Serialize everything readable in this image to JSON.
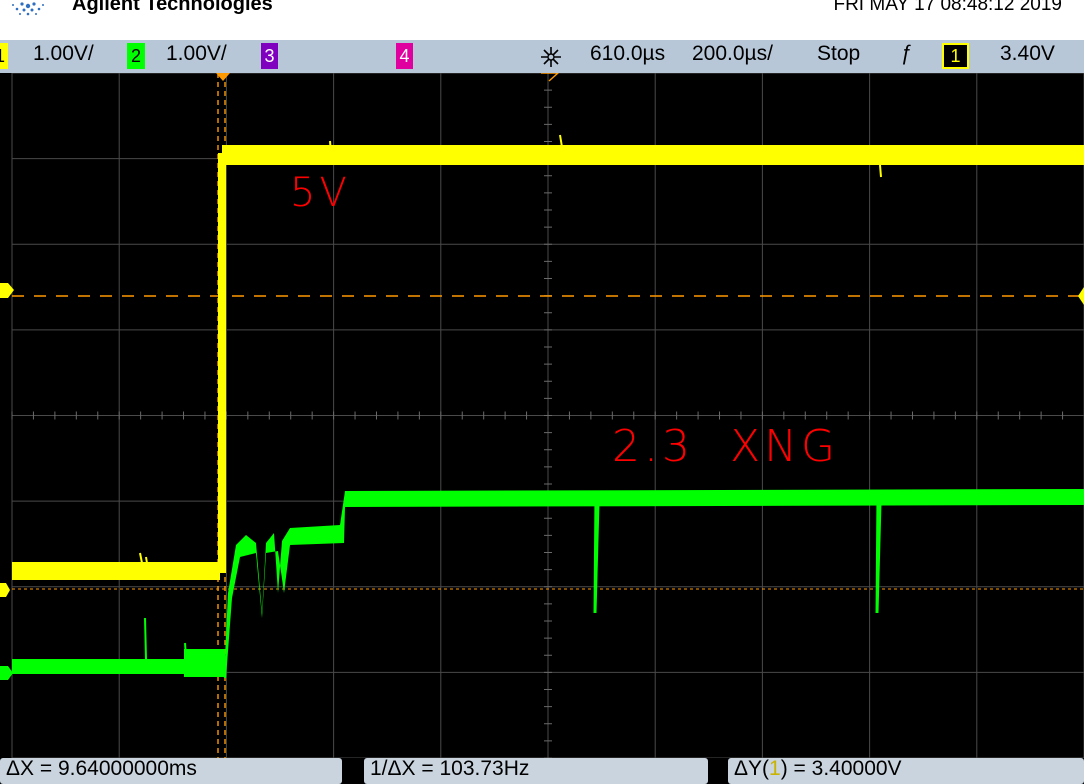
{
  "header": {
    "brand": "Agilent Technologies",
    "datetime": "FRI MAY 17 08:48:12 2019"
  },
  "status_bar": {
    "ch1_num": "1",
    "ch1_scale": "1.00V/",
    "ch2_num": "2",
    "ch2_scale": "1.00V/",
    "ch3_num": "3",
    "ch4_num": "4",
    "trigger_delay": "610.0µs",
    "timebase": "200.0µs/",
    "run_state": "Stop",
    "trigger_edge": "ƒ",
    "trigger_source": "1",
    "trigger_level": "3.40V"
  },
  "annotations": {
    "yellow_label": "5V",
    "green_label": "2.3  XNG"
  },
  "measurements": {
    "delta_x": "ΔX = 9.64000000ms",
    "inv_delta_x": "1/ΔX = 103.73Hz",
    "delta_y_prefix": "ΔY(",
    "delta_y_ch": "1",
    "delta_y_suffix": ") = 3.40000V"
  },
  "colors": {
    "ch1": "#ffff00",
    "ch2": "#00ff00",
    "ch3": "#8000c0",
    "ch4": "#e000a0",
    "cursor": "#ff9900",
    "annotation": "#ff0000",
    "status_bar": "#b7c7d8"
  }
}
